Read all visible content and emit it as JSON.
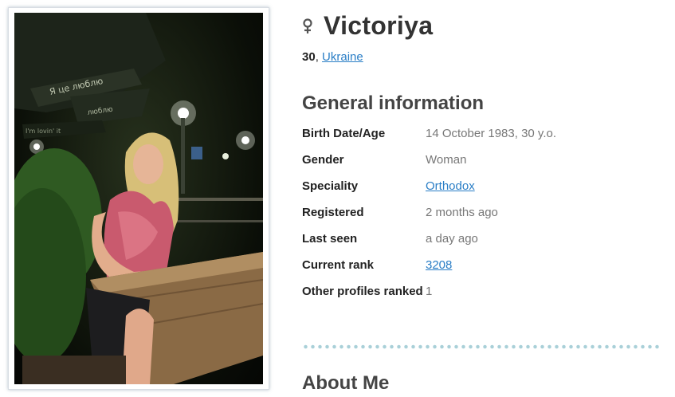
{
  "profile": {
    "name": "Victoriya",
    "age": "30",
    "age_separator": ", ",
    "country": "Ukraine",
    "gender_icon": "female-symbol-icon"
  },
  "general_info": {
    "title": "General information",
    "rows": [
      {
        "label": "Birth Date/Age",
        "value": "14 October 1983, 30 y.o."
      },
      {
        "label": "Gender",
        "value": "Woman"
      },
      {
        "label": "Speciality",
        "value": "Orthodox"
      },
      {
        "label": "Registered",
        "value": "2 months ago"
      },
      {
        "label": "Last seen",
        "value": "a day ago"
      },
      {
        "label": "Current rank",
        "value": "3208"
      },
      {
        "label": "Other profiles ranked",
        "value": "1"
      }
    ]
  },
  "about": {
    "title": "About Me"
  },
  "photo": {
    "sign_text_1": "Я це люблю",
    "sign_text_2": "люблю",
    "sign_text_3": "I'm lovin' it"
  },
  "colors": {
    "link": "#2a7ec6",
    "divider": "#a9d0d8",
    "frame_glow": "#788ca0"
  }
}
